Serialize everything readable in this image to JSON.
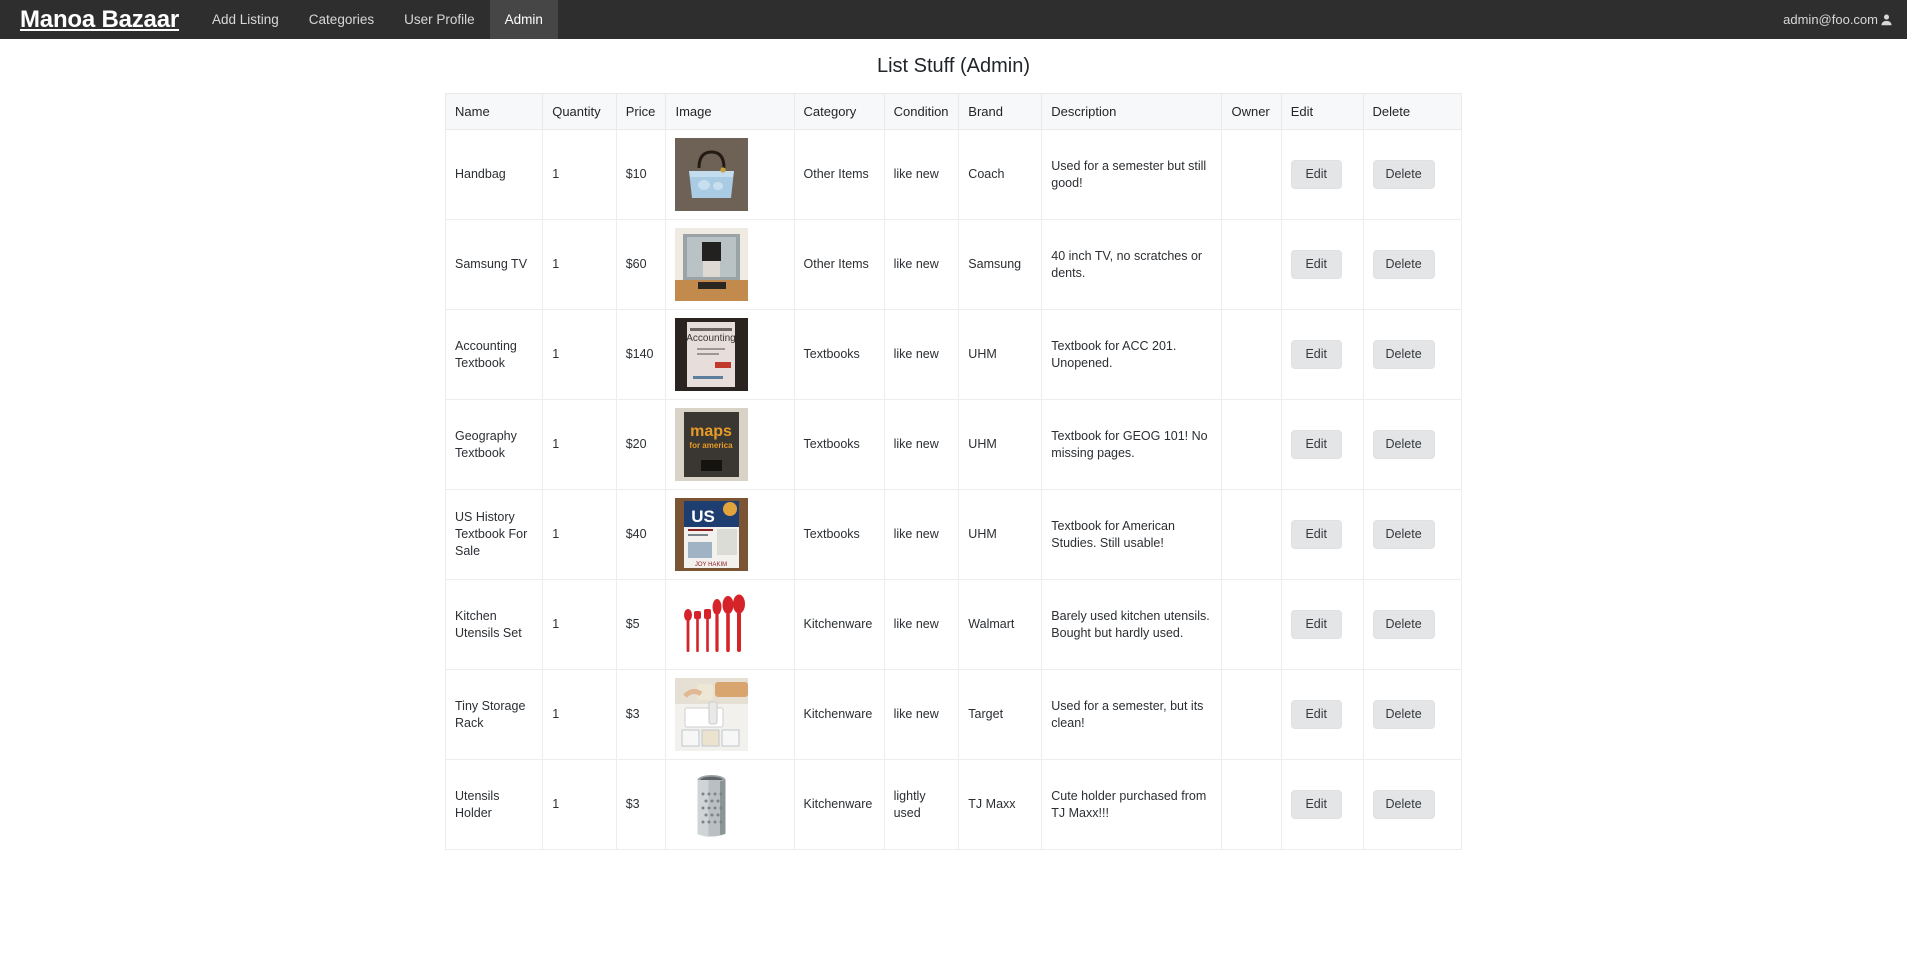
{
  "navbar": {
    "brand": "Manoa Bazaar",
    "links": [
      {
        "label": "Add Listing",
        "active": false
      },
      {
        "label": "Categories",
        "active": false
      },
      {
        "label": "User Profile",
        "active": false
      },
      {
        "label": "Admin",
        "active": true
      }
    ],
    "account_email": "admin@foo.com",
    "account_icon": "person-icon",
    "background_color": "#2e2e2e",
    "active_tab_color": "#464646"
  },
  "page": {
    "title": "List Stuff (Admin)"
  },
  "table": {
    "columns": [
      "Name",
      "Quantity",
      "Price",
      "Image",
      "Category",
      "Condition",
      "Brand",
      "Description",
      "Owner",
      "Edit",
      "Delete"
    ],
    "edit_label": "Edit",
    "delete_label": "Delete",
    "rows": [
      {
        "name": "Handbag",
        "quantity": "1",
        "price": "$10",
        "image": "handbag",
        "category": "Other Items",
        "condition": "like new",
        "brand": "Coach",
        "description": "Used for a semester but still good!",
        "owner": ""
      },
      {
        "name": "Samsung TV",
        "quantity": "1",
        "price": "$60",
        "image": "television",
        "category": "Other Items",
        "condition": "like new",
        "brand": "Samsung",
        "description": "40 inch TV, no scratches or dents.",
        "owner": ""
      },
      {
        "name": "Accounting Textbook",
        "quantity": "1",
        "price": "$140",
        "image": "accounting-book",
        "category": "Textbooks",
        "condition": "like new",
        "brand": "UHM",
        "description": "Textbook for ACC 201. Unopened.",
        "owner": ""
      },
      {
        "name": "Geography Textbook",
        "quantity": "1",
        "price": "$20",
        "image": "maps-book",
        "category": "Textbooks",
        "condition": "like new",
        "brand": "UHM",
        "description": "Textbook for GEOG 101! No missing pages.",
        "owner": ""
      },
      {
        "name": "US History Textbook For Sale",
        "quantity": "1",
        "price": "$40",
        "image": "us-history-book",
        "category": "Textbooks",
        "condition": "like new",
        "brand": "UHM",
        "description": "Textbook for American Studies. Still usable!",
        "owner": ""
      },
      {
        "name": "Kitchen Utensils Set",
        "quantity": "1",
        "price": "$5",
        "image": "red-utensils",
        "category": "Kitchenware",
        "condition": "like new",
        "brand": "Walmart",
        "description": "Barely used kitchen utensils. Bought but hardly used.",
        "owner": ""
      },
      {
        "name": "Tiny Storage Rack",
        "quantity": "1",
        "price": "$3",
        "image": "storage-rack",
        "category": "Kitchenware",
        "condition": "like new",
        "brand": "Target",
        "description": "Used for a semester, but its clean!",
        "owner": ""
      },
      {
        "name": "Utensils Holder",
        "quantity": "1",
        "price": "$3",
        "image": "utensils-holder",
        "category": "Kitchenware",
        "condition": "lightly used",
        "brand": "TJ Maxx",
        "description": "Cute holder purchased from TJ Maxx!!!",
        "owner": ""
      }
    ]
  }
}
